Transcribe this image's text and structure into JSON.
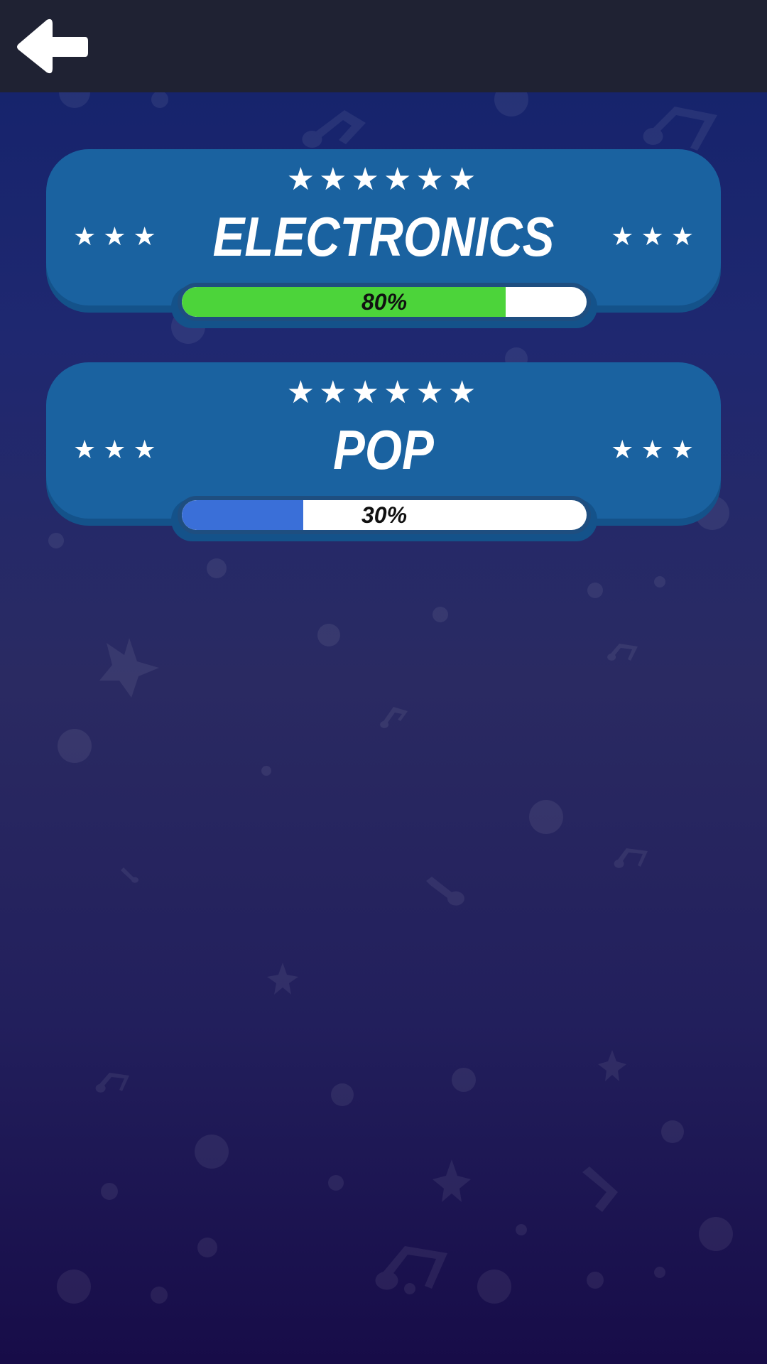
{
  "header": {
    "back_icon": "arrow-left-icon"
  },
  "categories": [
    {
      "title": "Electronics",
      "progress_label": "80%",
      "progress": 0.8,
      "fill_color": "#4cd43a",
      "stars_top": "★★★★★★",
      "stars_left": "★★★",
      "stars_right": "★★★"
    },
    {
      "title": "Pop",
      "progress_label": "30%",
      "progress": 0.3,
      "fill_color": "#3a6fd8",
      "stars_top": "★★★★★★",
      "stars_left": "★★★",
      "stars_right": "★★★"
    }
  ],
  "colors": {
    "topbar": "#1f2233",
    "card": "#1a62a0",
    "card_shadow": "#14528a"
  }
}
